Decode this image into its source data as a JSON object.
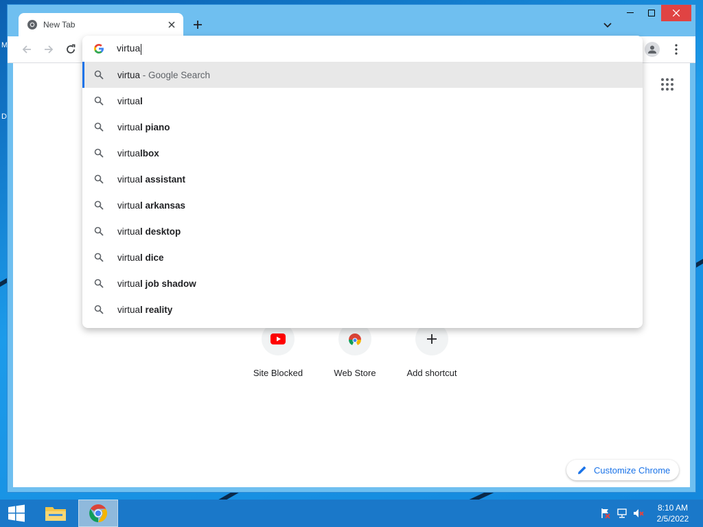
{
  "browser": {
    "tab": {
      "title": "New Tab"
    },
    "omnibox": {
      "typed": "virtua",
      "suggestions": [
        {
          "prefix": "virtua",
          "bold": "",
          "suffix": " - Google Search",
          "selected": true
        },
        {
          "prefix": "virtua",
          "bold": "l"
        },
        {
          "prefix": "virtua",
          "bold": "l piano"
        },
        {
          "prefix": "virtua",
          "bold": "lbox"
        },
        {
          "prefix": "virtua",
          "bold": "l assistant"
        },
        {
          "prefix": "virtua",
          "bold": "l arkansas"
        },
        {
          "prefix": "virtua",
          "bold": "l desktop"
        },
        {
          "prefix": "virtua",
          "bold": "l dice"
        },
        {
          "prefix": "virtua",
          "bold": "l job shadow"
        },
        {
          "prefix": "virtua",
          "bold": "l reality"
        }
      ]
    }
  },
  "newtab": {
    "shortcuts": [
      {
        "label": "Site Blocked",
        "icon": "youtube-icon"
      },
      {
        "label": "Web Store",
        "icon": "chrome-web-store-icon"
      },
      {
        "label": "Add shortcut",
        "icon": "plus-icon"
      }
    ],
    "customize_label": "Customize Chrome"
  },
  "desktop": {
    "edge_letters": [
      "M",
      "D"
    ]
  },
  "taskbar": {
    "time": "8:10 AM",
    "date": "2/5/2022"
  },
  "colors": {
    "accent": "#1a73e8",
    "close_button": "#e04343",
    "frame": "#6fbff0",
    "taskbar": "#1a78c9"
  }
}
